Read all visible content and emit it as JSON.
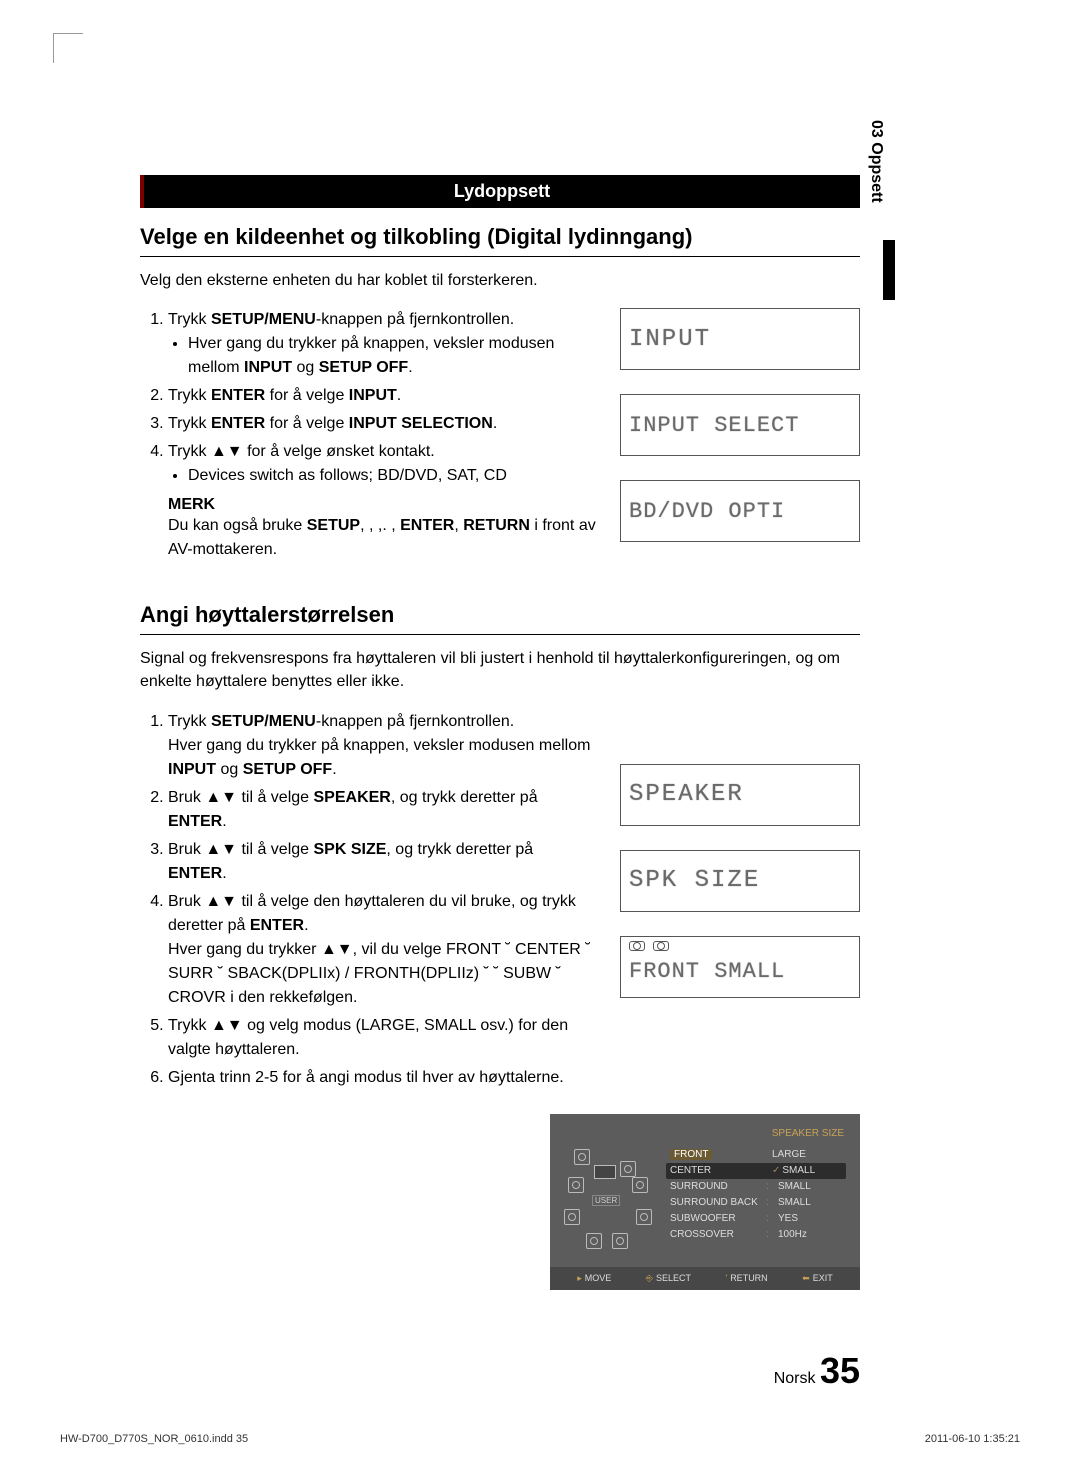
{
  "side_tab": "03  Oppsett",
  "section_bar": "Lydoppsett",
  "h_source": "Velge en kildeenhet og tilkobling (Digital lydinngang)",
  "intro_source": "Velg den eksterne enheten du har koblet til forsterkeren.",
  "src_steps": {
    "s1a": "Trykk ",
    "s1b": "SETUP/MENU",
    "s1c": "-knappen på fjernkontrollen.",
    "s1_bullet_a": "Hver gang du trykker på knappen, veksler modusen mellom ",
    "s1_bullet_b": "INPUT",
    "s1_bullet_c": " og ",
    "s1_bullet_d": "SETUP OFF",
    "s1_bullet_e": ".",
    "s2a": "Trykk ",
    "s2b": "ENTER",
    "s2c": " for å velge ",
    "s2d": "INPUT",
    "s2e": ".",
    "s3a": "Trykk ",
    "s3b": "ENTER",
    "s3c": " for å velge ",
    "s3d": "INPUT SELECTION",
    "s3e": ".",
    "s4a": "Trykk ▲▼ for å velge ønsket kontakt.",
    "s4_bullet": "Devices switch as follows; BD/DVD, SAT, CD"
  },
  "merk_head": "MERK",
  "merk_a": "Du kan også bruke ",
  "merk_b": "SETUP",
  "merk_c": ", ,   ,.   , ",
  "merk_d": "ENTER",
  "merk_e": ", ",
  "merk_f": "RETURN",
  "merk_g": " i front av AV-mottakeren.",
  "lcd1": "INPUT",
  "lcd2": "INPUT SELECT",
  "lcd3": "BD/DVD OPTI",
  "h_speaker": "Angi høyttalerstørrelsen",
  "intro_speaker": "Signal og frekvensrespons fra høyttaleren vil bli justert i henhold til høyttalerkonfigureringen, og om enkelte høyttalere benyttes eller ikke.",
  "spk_steps": {
    "s1a": "Trykk ",
    "s1b": "SETUP/MENU",
    "s1c": "-knappen på fjernkontrollen.",
    "s1_sub_a": "Hver gang du trykker på knappen, veksler modusen mellom ",
    "s1_sub_b": "INPUT",
    "s1_sub_c": " og ",
    "s1_sub_d": "SETUP OFF",
    "s1_sub_e": ".",
    "s2a": "Bruk ▲▼ til å velge ",
    "s2b": "SPEAKER",
    "s2c": ", og trykk deretter på ",
    "s2d": "ENTER",
    "s2e": ".",
    "s3a": "Bruk ▲▼ til å velge ",
    "s3b": "SPK SIZE",
    "s3c": ", og trykk deretter på ",
    "s3d": "ENTER",
    "s3e": ".",
    "s4a": "Bruk ▲▼ til å velge den høyttaleren du vil bruke, og trykk deretter på ",
    "s4b": "ENTER",
    "s4c": ".",
    "s4_sub": "Hver gang du trykker ▲▼, vil du velge FRONT ˘ CENTER ˘ SURR ˘ SBACK(DPLIIx) / FRONTH(DPLIIz) ˘ ˘ SUBW ˘ CROVR i den rekkefølgen.",
    "s5": "Trykk ▲▼ og velg modus (LARGE, SMALL osv.) for den valgte høyttaleren.",
    "s6": "Gjenta trinn 2-5 for å angi modus til hver av høyttalerne."
  },
  "lcd4": "SPEAKER",
  "lcd5": "SPK    SIZE",
  "lcd6": "FRONT  SMALL",
  "osd": {
    "title": "SPEAKER SIZE",
    "user": "USER",
    "rows": [
      {
        "label": "FRONT",
        "value": "LARGE",
        "highlight": true
      },
      {
        "label": "CENTER",
        "value": "SMALL",
        "check": true
      },
      {
        "label": "SURROUND",
        "value": "SMALL",
        "colon": true
      },
      {
        "label": "SURROUND BACK",
        "value": "SMALL",
        "colon": true
      },
      {
        "label": "SUBWOOFER",
        "value": "YES",
        "colon": true
      },
      {
        "label": "CROSSOVER",
        "value": "100Hz",
        "colon": true
      }
    ],
    "footer": {
      "move": "MOVE",
      "select": "SELECT",
      "return": "RETURN",
      "exit": "EXIT"
    }
  },
  "page_lang": "Norsk",
  "page_num": "35",
  "footer_file": "HW-D700_D770S_NOR_0610.indd   35",
  "footer_date": "2011-06-10    1:35:21"
}
